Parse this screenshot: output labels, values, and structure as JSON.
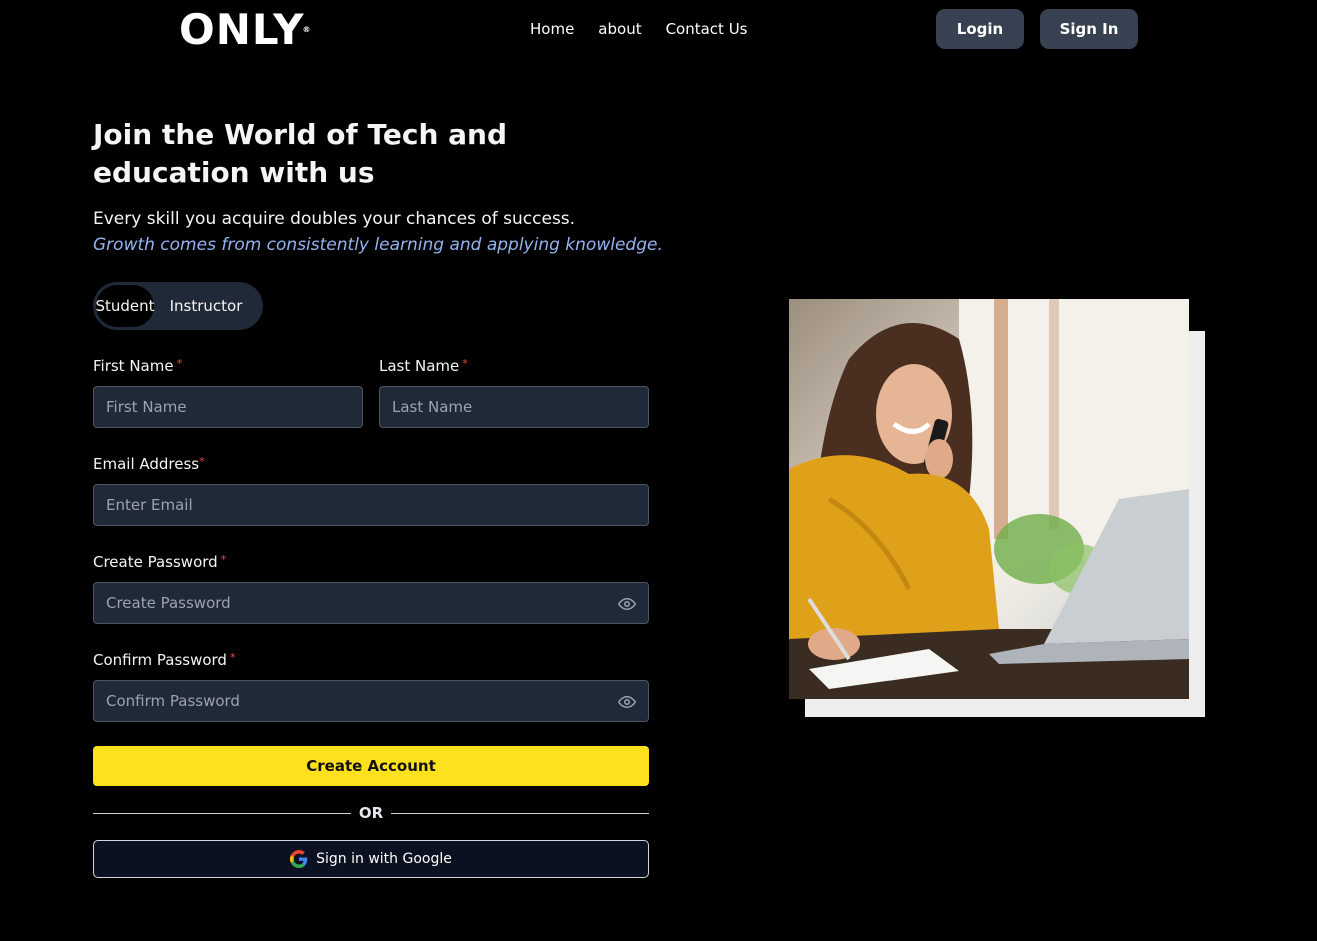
{
  "nav": {
    "logo": "ONLY",
    "logo_mark": "®",
    "links": [
      "Home",
      "about",
      "Contact Us"
    ],
    "login_label": "Login",
    "signin_label": "Sign In"
  },
  "hero": {
    "heading": "Join the World of Tech and education with us",
    "subtitle": "Every skill you acquire doubles your chances of success.",
    "tagline": "Growth comes from consistently learning and applying knowledge."
  },
  "role_toggle": {
    "options": [
      "Student",
      "Instructor"
    ],
    "selected": "Student"
  },
  "form": {
    "first_name": {
      "label": "First Name",
      "placeholder": "First Name",
      "value": ""
    },
    "last_name": {
      "label": "Last Name",
      "placeholder": "Last Name",
      "value": ""
    },
    "email": {
      "label": "Email Address",
      "placeholder": "Enter Email",
      "value": ""
    },
    "password": {
      "label": "Create Password",
      "placeholder": "Create Password",
      "value": ""
    },
    "confirm_password": {
      "label": "Confirm Password",
      "placeholder": "Confirm Password",
      "value": ""
    },
    "required_mark": "*",
    "submit_label": "Create Account",
    "divider_text": "OR",
    "google_label": "Sign in with Google"
  },
  "colors": {
    "background": "#000000",
    "accent": "#fde01e",
    "input_bg": "#1f2937",
    "nav_button_bg": "#374151",
    "tagline": "#93b4f0",
    "required": "#ef4444"
  },
  "icons": {
    "password_toggle": "eye-icon",
    "google": "google-icon"
  }
}
